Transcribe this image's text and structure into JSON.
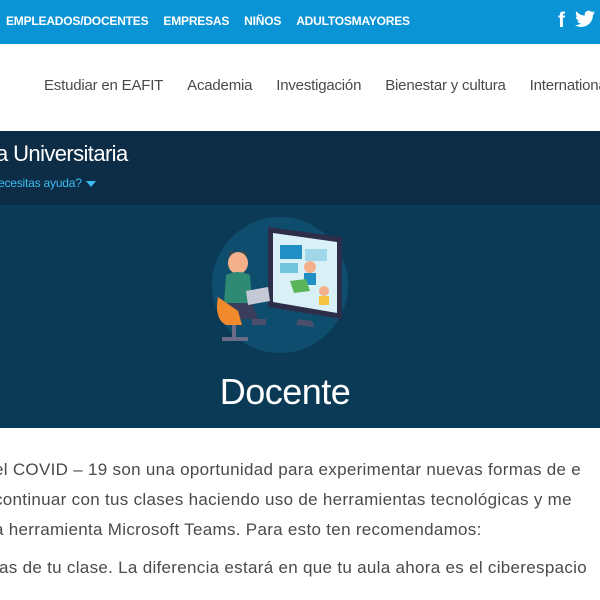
{
  "topbar": {
    "links": [
      "EMPLEADOS/DOCENTES",
      "EMPRESAS",
      "NIÑOS",
      "ADULTOSMAYORES"
    ],
    "social": {
      "facebook": "f",
      "twitter": "🐦"
    }
  },
  "mainnav": {
    "items": [
      "Estudiar en EAFIT",
      "Academia",
      "Investigación",
      "Bienestar y cultura",
      "International"
    ]
  },
  "hero": {
    "section_title": "a Universitaria",
    "help_link": "ecesitas ayuda?",
    "heading": "Docente"
  },
  "content": {
    "lines": [
      "el COVID – 19 son una oportunidad para experimentar nuevas formas de e",
      "continuar con tus clases haciendo uso de herramientas tecnológicas y me",
      "a herramienta Microsoft Teams. Para esto ten recomendamos:",
      "ías de tu clase. La diferencia estará en que tu aula ahora es el ciberespacio"
    ]
  },
  "colors": {
    "topbar": "#0a94d6",
    "hero_bg": "#0b3a56",
    "hero_head": "#0d2d46",
    "accent": "#3dbbf0"
  }
}
